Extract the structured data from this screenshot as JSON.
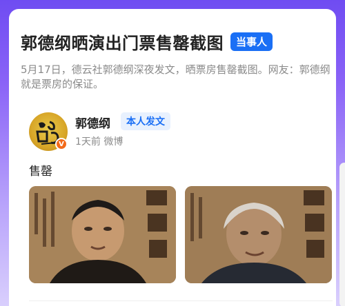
{
  "card": {
    "title": "郭德纲晒演出门票售罄截图",
    "role_badge": "当事人",
    "summary": "5月17日，德云社郭德纲深夜发文，晒票房售罄截图。网友：郭德纲就是票房的保证。"
  },
  "post": {
    "author": "郭德纲",
    "author_badge": "本人发文",
    "verified_mark": "V",
    "meta": "1天前 微博",
    "text": "售罄",
    "photos": [
      {
        "icon": "poster-photo-man"
      },
      {
        "icon": "poster-photo-elder"
      }
    ]
  },
  "colors": {
    "background_top": "#6f4cf2",
    "accent_blue": "#1a6ff5",
    "verified_orange": "#f26a1b"
  }
}
